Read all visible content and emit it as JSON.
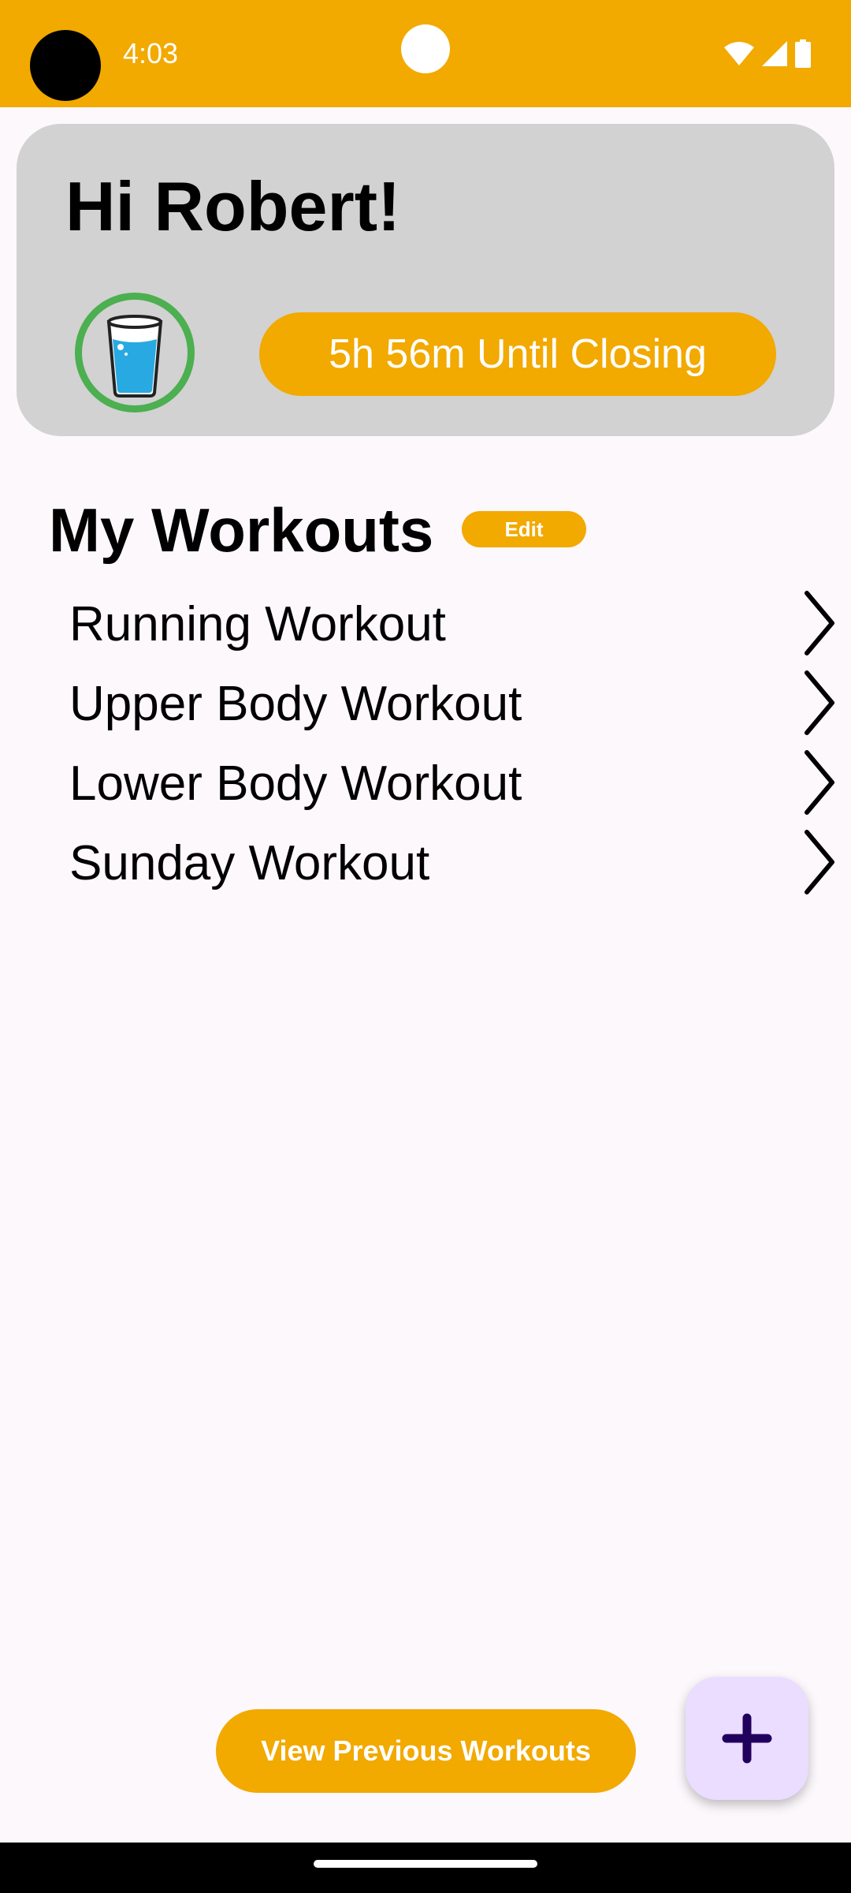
{
  "status_bar": {
    "time": "4:03",
    "icons": [
      "wifi-icon",
      "cellular-signal-icon",
      "battery-icon"
    ]
  },
  "greeting": {
    "title": "Hi Robert!",
    "water_icon": "water-glass-icon",
    "closing_label": "5h 56m Until Closing"
  },
  "workouts": {
    "title": "My Workouts",
    "edit_label": "Edit",
    "items": [
      {
        "label": "Running Workout"
      },
      {
        "label": "Upper Body Workout"
      },
      {
        "label": "Lower Body Workout"
      },
      {
        "label": "Sunday Workout"
      }
    ]
  },
  "footer": {
    "previous_label": "View Previous Workouts",
    "fab_icon": "plus-icon"
  },
  "colors": {
    "accent": "#f2a900",
    "card": "#d2d2d2",
    "ring": "#4caf50",
    "water": "#29a9e1",
    "fab_bg": "#eaddff",
    "fab_icon": "#21005d",
    "background": "#fdf8fc"
  }
}
